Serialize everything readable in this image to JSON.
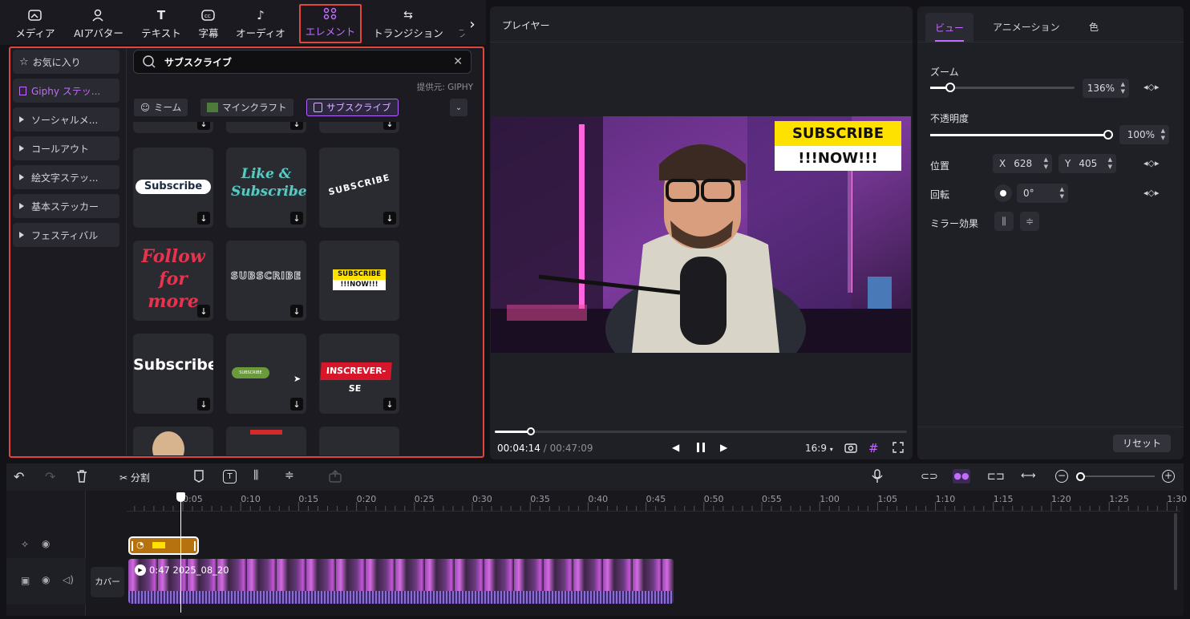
{
  "toolbar": {
    "tabs": [
      {
        "label": "メディア",
        "icon": "media-icon"
      },
      {
        "label": "AIアバター",
        "icon": "avatar-icon"
      },
      {
        "label": "テキスト",
        "icon": "text-icon"
      },
      {
        "label": "字幕",
        "icon": "caption-icon"
      },
      {
        "label": "オーディオ",
        "icon": "audio-icon"
      },
      {
        "label": "エレメント",
        "icon": "element-icon"
      },
      {
        "label": "トランジション",
        "icon": "transition-icon"
      },
      {
        "label": "フ",
        "icon": "filter-icon"
      }
    ],
    "active_tab": "エレメント"
  },
  "sidebar": {
    "items": [
      {
        "label": "お気に入り",
        "icon": "star-icon"
      },
      {
        "label": "Giphy ステッ...",
        "icon": "giphy-icon"
      },
      {
        "label": "ソーシャルメ...",
        "icon": "expand-triangle"
      },
      {
        "label": "コールアウト",
        "icon": "expand-triangle"
      },
      {
        "label": "絵文字ステッ...",
        "icon": "expand-triangle"
      },
      {
        "label": "基本ステッカー",
        "icon": "expand-triangle"
      },
      {
        "label": "フェスティバル",
        "icon": "expand-triangle"
      }
    ]
  },
  "search": {
    "value": "サブスクライブ",
    "provider": "提供元: GIPHY"
  },
  "chips": [
    {
      "label": "ミーム",
      "icon": "smile-icon"
    },
    {
      "label": "マインクラフト",
      "icon": "creeper-icon"
    },
    {
      "label": "サブスクライブ",
      "icon": "subscribe-icon"
    }
  ],
  "stickers": [
    {
      "text": "Subscribe",
      "style": "pill"
    },
    {
      "text": "Like & Subscribe",
      "style": "script-teal"
    },
    {
      "text": "SUBSCRIBE",
      "style": "curved"
    },
    {
      "text": "Follow for more",
      "style": "script-red"
    },
    {
      "text": "SUBSCRIBE",
      "style": "outline"
    },
    {
      "text_line1": "SUBSCRIBE",
      "text_line2": "!!!NOW!!!",
      "style": "yellow-block"
    },
    {
      "text": "Subscribe",
      "style": "plain-white"
    },
    {
      "text": "SUBSCRIBE",
      "style": "green-pill"
    },
    {
      "text": "INSCREVER-SE",
      "style": "red-banner"
    }
  ],
  "player": {
    "title": "プレイヤー",
    "overlay_line1": "SUBSCRIBE",
    "overlay_line2": "!!!NOW!!!",
    "current_time": "00:04:14",
    "separator": "/",
    "total_time": "00:47:09",
    "aspect": "16:9",
    "progress": 0.09
  },
  "inspector": {
    "tabs": [
      "ビュー",
      "アニメーション",
      "色"
    ],
    "active_tab": "ビュー",
    "zoom_label": "ズーム",
    "zoom_value": "136%",
    "zoom_level": 0.14,
    "opacity_label": "不透明度",
    "opacity_value": "100%",
    "opacity_level": 1.0,
    "position_label": "位置",
    "pos_x_label": "X",
    "pos_x": "628",
    "pos_y_label": "Y",
    "pos_y": "405",
    "rotation_label": "回転",
    "rotation_value": "0°",
    "mirror_label": "ミラー効果",
    "reset_label": "リセット"
  },
  "timeline": {
    "split_label": "分割",
    "ruler": [
      "0:05",
      "0:10",
      "0:15",
      "0:20",
      "0:25",
      "0:30",
      "0:35",
      "0:40",
      "0:45",
      "0:50",
      "0:55",
      "1:00",
      "1:05",
      "1:10",
      "1:15",
      "1:20",
      "1:25",
      "1:30"
    ],
    "cover_label": "カバー",
    "clip_label": "0:47 2025_08_20"
  },
  "colors": {
    "accent": "#c26bff",
    "highlight": "#e0473a",
    "sticker_clip": "#b5720f"
  }
}
